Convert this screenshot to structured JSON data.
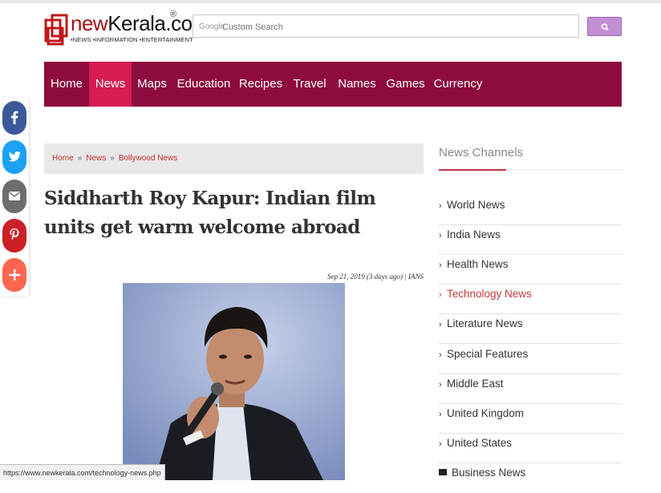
{
  "logo": {
    "brand_prefix": "new",
    "brand_main": "Kerala.com",
    "registered": "®",
    "tagline": "•NEWS •INFORMATION •ENTERTAINMENT"
  },
  "search": {
    "google_label": "Google",
    "placeholder": "Custom Search",
    "button_icon": "search-icon"
  },
  "nav": {
    "items": [
      {
        "label": "Home"
      },
      {
        "label": "News",
        "active": true
      },
      {
        "label": "Maps"
      },
      {
        "label": "Education"
      },
      {
        "label": "Recipes"
      },
      {
        "label": "Travel"
      },
      {
        "label": "Names"
      },
      {
        "label": "Games"
      },
      {
        "label": "Currency"
      }
    ]
  },
  "share": {
    "buttons": [
      {
        "name": "facebook-icon",
        "glyph": "f",
        "color": "#3b5998"
      },
      {
        "name": "twitter-icon",
        "glyph": "t",
        "color": "#1da1f2"
      },
      {
        "name": "email-icon",
        "glyph": "✉",
        "color": "#6d6d6d"
      },
      {
        "name": "pinterest-icon",
        "glyph": "p",
        "color": "#cb2027"
      },
      {
        "name": "more-icon",
        "glyph": "+",
        "color": "#ff6550"
      }
    ]
  },
  "breadcrumb": {
    "items": [
      "Home",
      "News",
      "Bollywood News"
    ],
    "separator": "»"
  },
  "article": {
    "title": "Siddharth Roy Kapur: Indian film units get warm welcome abroad",
    "meta": "Sep 21, 2019 (3 days ago) | IANS"
  },
  "sidebar": {
    "title": "News Channels",
    "items": [
      {
        "label": "World News"
      },
      {
        "label": "India News"
      },
      {
        "label": "Health News"
      },
      {
        "label": "Technology News",
        "active": true
      },
      {
        "label": "Literature News"
      },
      {
        "label": "Special Features"
      },
      {
        "label": "Middle East"
      },
      {
        "label": "United Kingdom"
      },
      {
        "label": "United States"
      },
      {
        "label": "Business News",
        "icon": "folder-icon"
      }
    ]
  },
  "status_bar": {
    "url": "https://www.newkerala.com/technology-news.php"
  },
  "colors": {
    "nav_bg": "#8e0b3e",
    "nav_active": "#d61c53",
    "accent_red": "#c63a3a",
    "search_button": "#c28fd5"
  }
}
